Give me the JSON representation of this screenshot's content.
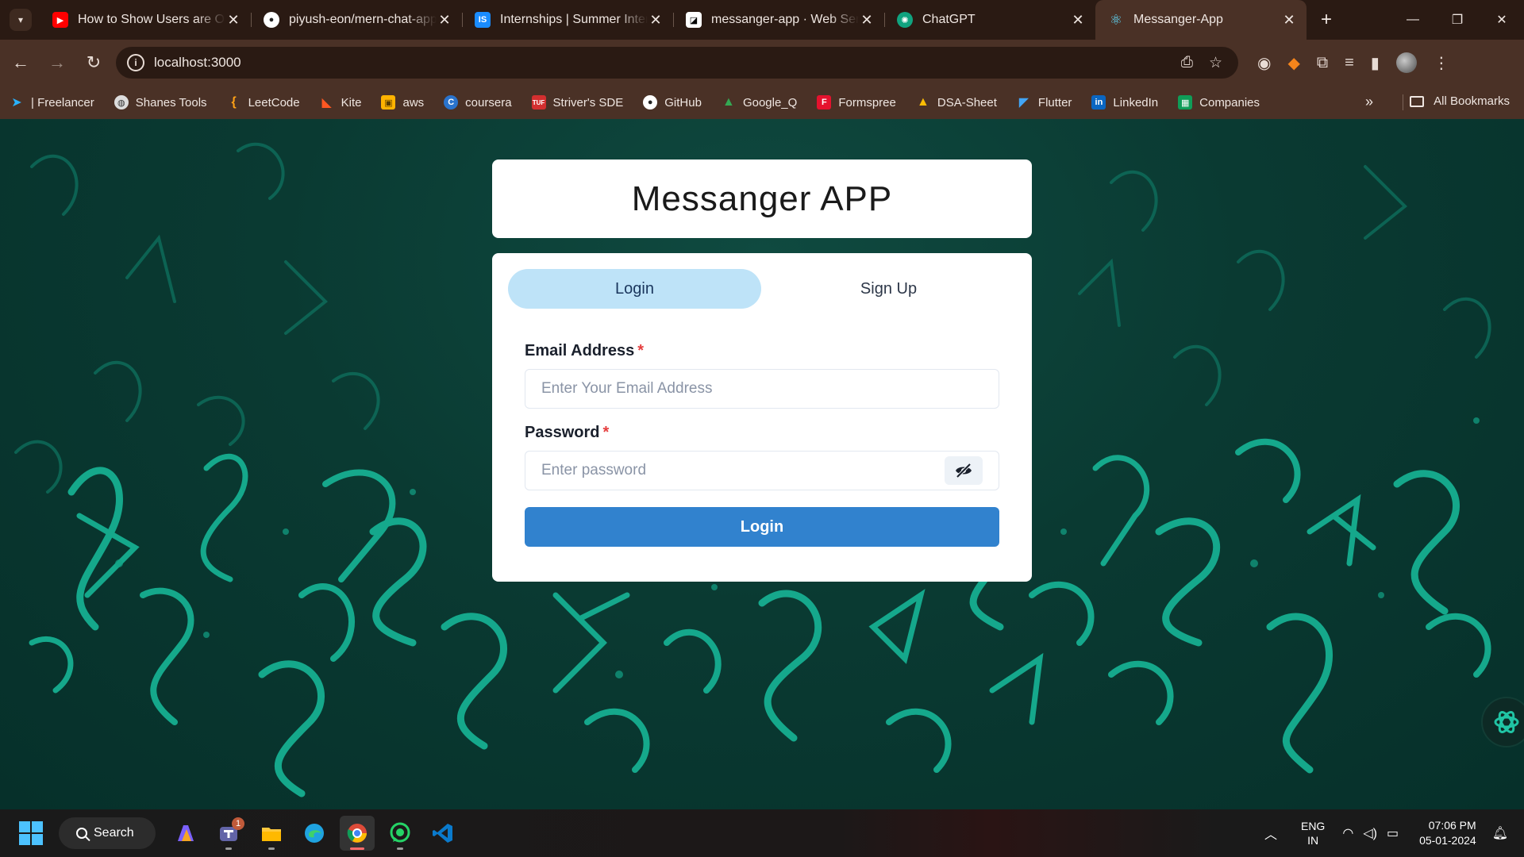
{
  "browser": {
    "tabs": [
      {
        "title": "How to Show Users are Offline",
        "favicon": "youtube-icon",
        "color": "#ff0000",
        "active": false
      },
      {
        "title": "piyush-eon/mern-chat-app",
        "favicon": "github-icon",
        "color": "#ffffff",
        "active": false
      },
      {
        "title": "Internships | Summer Internships",
        "favicon": "internshala-icon",
        "color": "#1a8cff",
        "active": false
      },
      {
        "title": "messanger-app · Web Service",
        "favicon": "render-icon",
        "color": "#ffffff",
        "active": false
      },
      {
        "title": "ChatGPT",
        "favicon": "chatgpt-icon",
        "color": "#1f1f1f",
        "active": false
      },
      {
        "title": "Messanger-App",
        "favicon": "react-icon",
        "color": "#61dafb",
        "active": true
      }
    ],
    "url": "localhost:3000",
    "bookmarks": [
      {
        "label": "| Freelancer",
        "icon": "freelancer-icon",
        "color": "#29b2fe"
      },
      {
        "label": "Shanes Tools",
        "icon": "globe-icon",
        "color": "#dddddd"
      },
      {
        "label": "LeetCode",
        "icon": "leetcode-icon",
        "color": "#ffa116"
      },
      {
        "label": "Kite",
        "icon": "kite-icon",
        "color": "#ff5722"
      },
      {
        "label": "aws",
        "icon": "aws-icon",
        "color": "#ffb300"
      },
      {
        "label": "coursera",
        "icon": "coursera-icon",
        "color": "#2a73cc"
      },
      {
        "label": "Striver's SDE",
        "icon": "tuf-icon",
        "color": "#d32f2f"
      },
      {
        "label": "GitHub",
        "icon": "github-icon",
        "color": "#ffffff"
      },
      {
        "label": "Google_Q",
        "icon": "drive-icon",
        "color": "#34a853"
      },
      {
        "label": "Formspree",
        "icon": "formspree-icon",
        "color": "#e5122e"
      },
      {
        "label": "DSA-Sheet",
        "icon": "drive-icon",
        "color": "#fbbc04"
      },
      {
        "label": "Flutter",
        "icon": "flutter-icon",
        "color": "#42a5f5"
      },
      {
        "label": "LinkedIn",
        "icon": "linkedin-icon",
        "color": "#0a66c2"
      },
      {
        "label": "Companies",
        "icon": "sheets-icon",
        "color": "#0f9d58"
      }
    ],
    "all_bookmarks": "All Bookmarks"
  },
  "app": {
    "title": "Messanger APP",
    "tabs": {
      "login": "Login",
      "signup": "Sign Up"
    },
    "email_label": "Email Address",
    "email_placeholder": "Enter Your Email Address",
    "password_label": "Password",
    "password_placeholder": "Enter password",
    "required_mark": "*",
    "submit_label": "Login"
  },
  "taskbar": {
    "search_label": "Search",
    "apps": [
      {
        "name": "copilot-icon",
        "color": "#7b61ff"
      },
      {
        "name": "teams-icon",
        "color": "#6264a7",
        "badge": "1"
      },
      {
        "name": "file-explorer-icon",
        "color": "#ffc83d"
      },
      {
        "name": "edge-icon",
        "color": "#1fa3e0"
      },
      {
        "name": "chrome-icon",
        "color": "#dd4b39"
      },
      {
        "name": "whatsapp-icon",
        "color": "#25d366"
      },
      {
        "name": "vscode-icon",
        "color": "#0a7acc"
      }
    ],
    "language": "ENG",
    "region": "IN",
    "time": "07:06 PM",
    "date": "05-01-2024"
  },
  "colors": {
    "accent": "#3182ce",
    "tab_selected": "#bee3f8",
    "page_bg": "#0a3a32",
    "glyph": "#18b89a"
  }
}
